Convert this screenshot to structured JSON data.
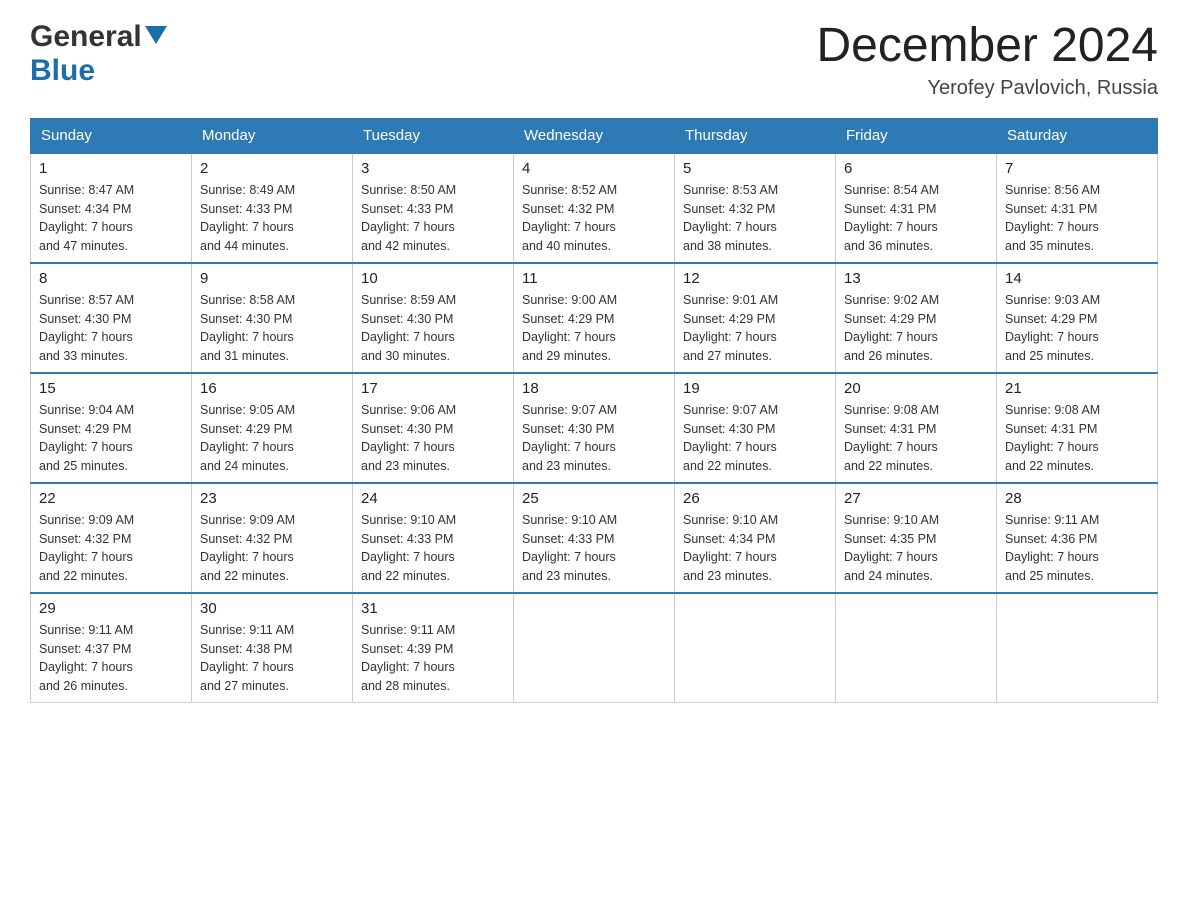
{
  "header": {
    "logo_general": "General",
    "logo_blue": "Blue",
    "month_title": "December 2024",
    "location": "Yerofey Pavlovich, Russia"
  },
  "calendar": {
    "days_of_week": [
      "Sunday",
      "Monday",
      "Tuesday",
      "Wednesday",
      "Thursday",
      "Friday",
      "Saturday"
    ],
    "weeks": [
      [
        {
          "date": "1",
          "sunrise": "Sunrise: 8:47 AM",
          "sunset": "Sunset: 4:34 PM",
          "daylight": "Daylight: 7 hours",
          "minutes": "and 47 minutes."
        },
        {
          "date": "2",
          "sunrise": "Sunrise: 8:49 AM",
          "sunset": "Sunset: 4:33 PM",
          "daylight": "Daylight: 7 hours",
          "minutes": "and 44 minutes."
        },
        {
          "date": "3",
          "sunrise": "Sunrise: 8:50 AM",
          "sunset": "Sunset: 4:33 PM",
          "daylight": "Daylight: 7 hours",
          "minutes": "and 42 minutes."
        },
        {
          "date": "4",
          "sunrise": "Sunrise: 8:52 AM",
          "sunset": "Sunset: 4:32 PM",
          "daylight": "Daylight: 7 hours",
          "minutes": "and 40 minutes."
        },
        {
          "date": "5",
          "sunrise": "Sunrise: 8:53 AM",
          "sunset": "Sunset: 4:32 PM",
          "daylight": "Daylight: 7 hours",
          "minutes": "and 38 minutes."
        },
        {
          "date": "6",
          "sunrise": "Sunrise: 8:54 AM",
          "sunset": "Sunset: 4:31 PM",
          "daylight": "Daylight: 7 hours",
          "minutes": "and 36 minutes."
        },
        {
          "date": "7",
          "sunrise": "Sunrise: 8:56 AM",
          "sunset": "Sunset: 4:31 PM",
          "daylight": "Daylight: 7 hours",
          "minutes": "and 35 minutes."
        }
      ],
      [
        {
          "date": "8",
          "sunrise": "Sunrise: 8:57 AM",
          "sunset": "Sunset: 4:30 PM",
          "daylight": "Daylight: 7 hours",
          "minutes": "and 33 minutes."
        },
        {
          "date": "9",
          "sunrise": "Sunrise: 8:58 AM",
          "sunset": "Sunset: 4:30 PM",
          "daylight": "Daylight: 7 hours",
          "minutes": "and 31 minutes."
        },
        {
          "date": "10",
          "sunrise": "Sunrise: 8:59 AM",
          "sunset": "Sunset: 4:30 PM",
          "daylight": "Daylight: 7 hours",
          "minutes": "and 30 minutes."
        },
        {
          "date": "11",
          "sunrise": "Sunrise: 9:00 AM",
          "sunset": "Sunset: 4:29 PM",
          "daylight": "Daylight: 7 hours",
          "minutes": "and 29 minutes."
        },
        {
          "date": "12",
          "sunrise": "Sunrise: 9:01 AM",
          "sunset": "Sunset: 4:29 PM",
          "daylight": "Daylight: 7 hours",
          "minutes": "and 27 minutes."
        },
        {
          "date": "13",
          "sunrise": "Sunrise: 9:02 AM",
          "sunset": "Sunset: 4:29 PM",
          "daylight": "Daylight: 7 hours",
          "minutes": "and 26 minutes."
        },
        {
          "date": "14",
          "sunrise": "Sunrise: 9:03 AM",
          "sunset": "Sunset: 4:29 PM",
          "daylight": "Daylight: 7 hours",
          "minutes": "and 25 minutes."
        }
      ],
      [
        {
          "date": "15",
          "sunrise": "Sunrise: 9:04 AM",
          "sunset": "Sunset: 4:29 PM",
          "daylight": "Daylight: 7 hours",
          "minutes": "and 25 minutes."
        },
        {
          "date": "16",
          "sunrise": "Sunrise: 9:05 AM",
          "sunset": "Sunset: 4:29 PM",
          "daylight": "Daylight: 7 hours",
          "minutes": "and 24 minutes."
        },
        {
          "date": "17",
          "sunrise": "Sunrise: 9:06 AM",
          "sunset": "Sunset: 4:30 PM",
          "daylight": "Daylight: 7 hours",
          "minutes": "and 23 minutes."
        },
        {
          "date": "18",
          "sunrise": "Sunrise: 9:07 AM",
          "sunset": "Sunset: 4:30 PM",
          "daylight": "Daylight: 7 hours",
          "minutes": "and 23 minutes."
        },
        {
          "date": "19",
          "sunrise": "Sunrise: 9:07 AM",
          "sunset": "Sunset: 4:30 PM",
          "daylight": "Daylight: 7 hours",
          "minutes": "and 22 minutes."
        },
        {
          "date": "20",
          "sunrise": "Sunrise: 9:08 AM",
          "sunset": "Sunset: 4:31 PM",
          "daylight": "Daylight: 7 hours",
          "minutes": "and 22 minutes."
        },
        {
          "date": "21",
          "sunrise": "Sunrise: 9:08 AM",
          "sunset": "Sunset: 4:31 PM",
          "daylight": "Daylight: 7 hours",
          "minutes": "and 22 minutes."
        }
      ],
      [
        {
          "date": "22",
          "sunrise": "Sunrise: 9:09 AM",
          "sunset": "Sunset: 4:32 PM",
          "daylight": "Daylight: 7 hours",
          "minutes": "and 22 minutes."
        },
        {
          "date": "23",
          "sunrise": "Sunrise: 9:09 AM",
          "sunset": "Sunset: 4:32 PM",
          "daylight": "Daylight: 7 hours",
          "minutes": "and 22 minutes."
        },
        {
          "date": "24",
          "sunrise": "Sunrise: 9:10 AM",
          "sunset": "Sunset: 4:33 PM",
          "daylight": "Daylight: 7 hours",
          "minutes": "and 22 minutes."
        },
        {
          "date": "25",
          "sunrise": "Sunrise: 9:10 AM",
          "sunset": "Sunset: 4:33 PM",
          "daylight": "Daylight: 7 hours",
          "minutes": "and 23 minutes."
        },
        {
          "date": "26",
          "sunrise": "Sunrise: 9:10 AM",
          "sunset": "Sunset: 4:34 PM",
          "daylight": "Daylight: 7 hours",
          "minutes": "and 23 minutes."
        },
        {
          "date": "27",
          "sunrise": "Sunrise: 9:10 AM",
          "sunset": "Sunset: 4:35 PM",
          "daylight": "Daylight: 7 hours",
          "minutes": "and 24 minutes."
        },
        {
          "date": "28",
          "sunrise": "Sunrise: 9:11 AM",
          "sunset": "Sunset: 4:36 PM",
          "daylight": "Daylight: 7 hours",
          "minutes": "and 25 minutes."
        }
      ],
      [
        {
          "date": "29",
          "sunrise": "Sunrise: 9:11 AM",
          "sunset": "Sunset: 4:37 PM",
          "daylight": "Daylight: 7 hours",
          "minutes": "and 26 minutes."
        },
        {
          "date": "30",
          "sunrise": "Sunrise: 9:11 AM",
          "sunset": "Sunset: 4:38 PM",
          "daylight": "Daylight: 7 hours",
          "minutes": "and 27 minutes."
        },
        {
          "date": "31",
          "sunrise": "Sunrise: 9:11 AM",
          "sunset": "Sunset: 4:39 PM",
          "daylight": "Daylight: 7 hours",
          "minutes": "and 28 minutes."
        },
        null,
        null,
        null,
        null
      ]
    ]
  }
}
